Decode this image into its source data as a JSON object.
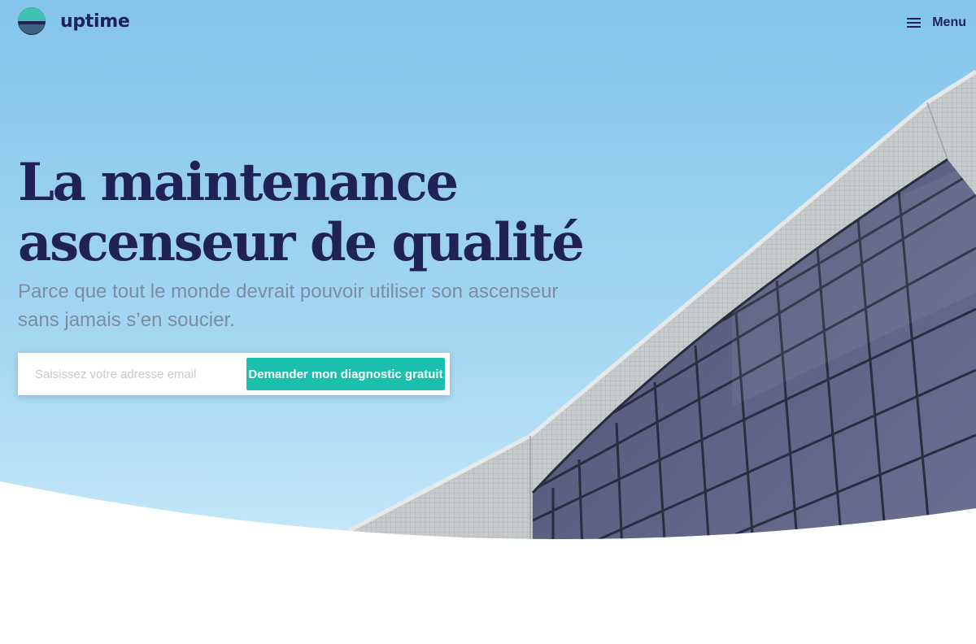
{
  "brand": {
    "name": "uptime",
    "logo_icon": "uptime-logo-icon",
    "colors": {
      "navy": "#1f2157",
      "teal": "#1abfae",
      "sky_top": "#84c4eb",
      "sky_bottom": "#cdeef9"
    }
  },
  "header": {
    "menu_label": "Menu",
    "menu_icon": "hamburger-menu-icon"
  },
  "hero": {
    "title_lines": [
      "La maintenance",
      "ascenseur de qualité"
    ],
    "subtitle_lines": [
      "Parce que tout le monde devrait pouvoir utiliser son ascenseur",
      "sans jamais s’en soucier."
    ],
    "email_placeholder": "Saisissez votre adresse email",
    "email_value": "",
    "cta_label": "Demander mon diagnostic gratuit",
    "background_image": "building-facade-sky-photo"
  }
}
